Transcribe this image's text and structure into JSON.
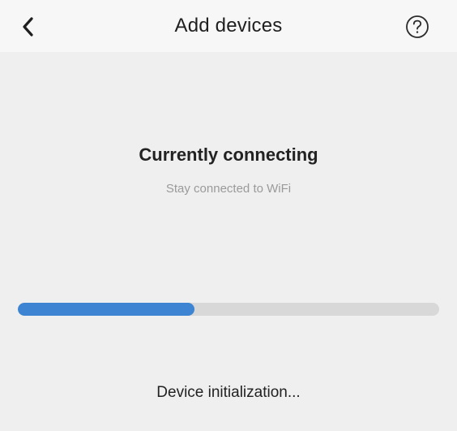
{
  "header": {
    "title": "Add devices",
    "back_icon": "chevron-left-icon",
    "help_icon": "question-circle-icon"
  },
  "status": {
    "title": "Currently connecting",
    "subtitle": "Stay connected to WiFi"
  },
  "progress": {
    "percent": 42,
    "fill_color": "#3d84d2",
    "track_color": "#d8d8d8"
  },
  "step": {
    "text": "Device initialization..."
  }
}
